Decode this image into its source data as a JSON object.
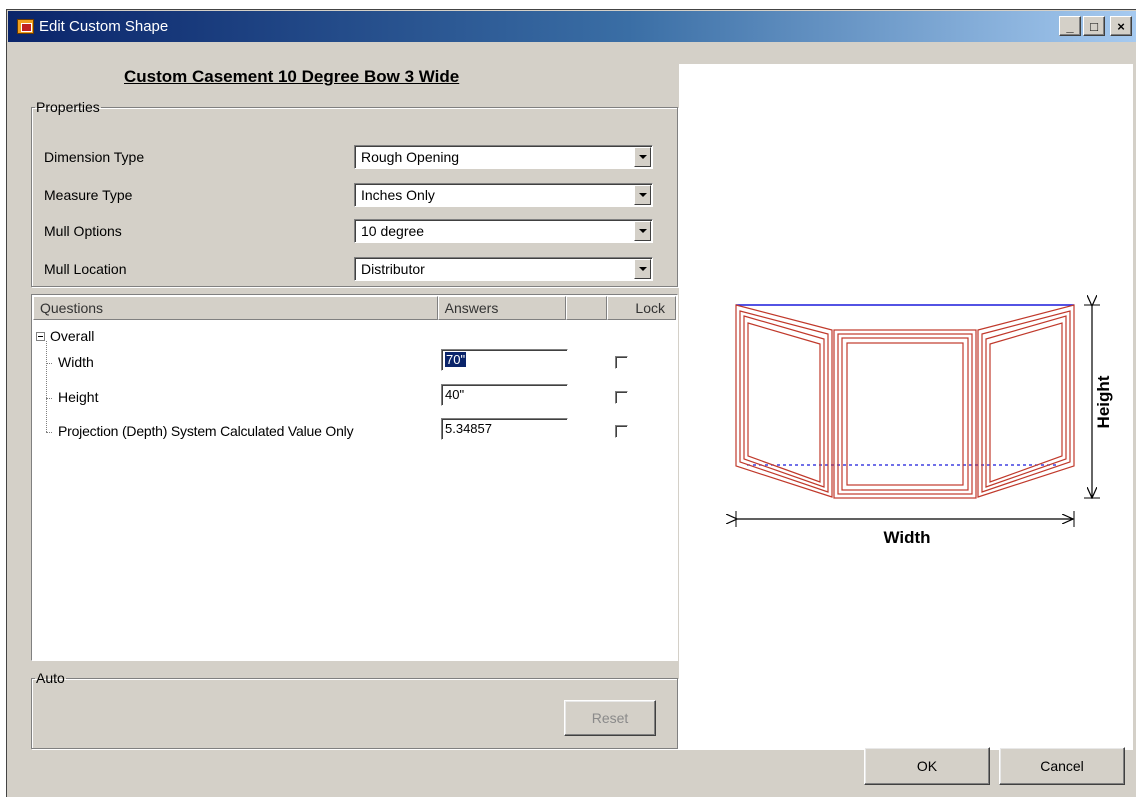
{
  "window": {
    "title": "Edit Custom Shape",
    "controls": {
      "minimize": "_",
      "maximize": "□",
      "close": "×"
    }
  },
  "heading": "Custom Casement 10 Degree Bow 3 Wide",
  "properties": {
    "legend": "Properties",
    "rows": [
      {
        "label": "Dimension Type",
        "value": "Rough Opening"
      },
      {
        "label": "Measure Type",
        "value": "Inches Only"
      },
      {
        "label": "Mull Options",
        "value": "10 degree"
      },
      {
        "label": "Mull Location",
        "value": "Distributor"
      }
    ]
  },
  "questions": {
    "columns": {
      "questions": "Questions",
      "answers": "Answers",
      "blank": "",
      "lock": "Lock"
    },
    "group": "Overall",
    "items": [
      {
        "label": "Width",
        "answer": "70\"",
        "locked": false,
        "selected": true
      },
      {
        "label": "Height",
        "answer": "40\"",
        "locked": false,
        "selected": false
      },
      {
        "label": "Projection (Depth) System Calculated Value Only",
        "answer": "5.34857",
        "locked": false,
        "selected": false
      }
    ]
  },
  "auto": {
    "legend": "Auto",
    "reset_label": "Reset",
    "reset_enabled": false
  },
  "preview": {
    "width_label": "Width",
    "height_label": "Height",
    "frame_color": "#c0392b",
    "line_color": "#1a1adb"
  },
  "buttons": {
    "ok": "OK",
    "cancel": "Cancel"
  }
}
